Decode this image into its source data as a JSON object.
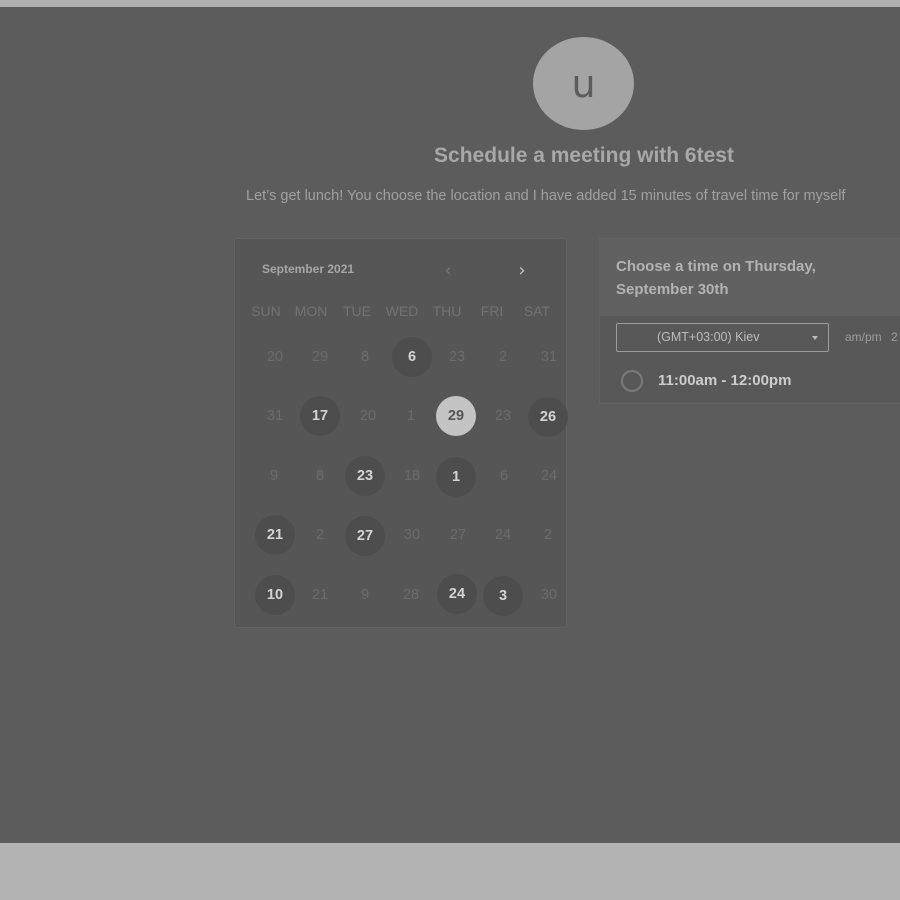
{
  "avatar": {
    "initial": "u"
  },
  "title": "Schedule a meeting with 6test",
  "description": "Let’s get lunch! You choose the location and I have added 15 minutes of travel time for myself",
  "calendar": {
    "month_label": "September 2021",
    "prev_icon": "chevron-left-icon",
    "next_icon": "chevron-right-icon",
    "weekdays": [
      "SUN",
      "MON",
      "TUE",
      "WED",
      "THU",
      "FRI",
      "SAT"
    ],
    "weeks": [
      [
        {
          "d": "20",
          "s": "off"
        },
        {
          "d": "29",
          "s": "off"
        },
        {
          "d": "8",
          "s": "off"
        },
        {
          "d": "6",
          "s": "avail"
        },
        {
          "d": "23",
          "s": "off"
        },
        {
          "d": "2",
          "s": "off"
        },
        {
          "d": "31",
          "s": "off"
        }
      ],
      [
        {
          "d": "31",
          "s": "off"
        },
        {
          "d": "17",
          "s": "avail"
        },
        {
          "d": "20",
          "s": "off"
        },
        {
          "d": "1",
          "s": "off"
        },
        {
          "d": "29",
          "s": "selected"
        },
        {
          "d": "23",
          "s": "off"
        },
        {
          "d": "26",
          "s": "avail"
        }
      ],
      [
        {
          "d": "9",
          "s": "off"
        },
        {
          "d": "8",
          "s": "off"
        },
        {
          "d": "23",
          "s": "avail"
        },
        {
          "d": "18",
          "s": "off"
        },
        {
          "d": "1",
          "s": "avail"
        },
        {
          "d": "6",
          "s": "off"
        },
        {
          "d": "24",
          "s": "off"
        }
      ],
      [
        {
          "d": "21",
          "s": "avail"
        },
        {
          "d": "2",
          "s": "off"
        },
        {
          "d": "27",
          "s": "avail"
        },
        {
          "d": "30",
          "s": "off"
        },
        {
          "d": "27",
          "s": "off"
        },
        {
          "d": "24",
          "s": "off"
        },
        {
          "d": "2",
          "s": "off"
        }
      ],
      [
        {
          "d": "10",
          "s": "avail"
        },
        {
          "d": "21",
          "s": "off"
        },
        {
          "d": "9",
          "s": "off"
        },
        {
          "d": "28",
          "s": "off"
        },
        {
          "d": "24",
          "s": "avail"
        },
        {
          "d": "3",
          "s": "avail"
        },
        {
          "d": "30",
          "s": "off"
        }
      ]
    ]
  },
  "times": {
    "heading": "Choose a time on Thursday, September 30th",
    "timezone": "(GMT+03:00) Kiev",
    "format_label": "am/pm",
    "format_extra": "2",
    "slots": [
      {
        "label": "11:00am - 12:00pm"
      }
    ]
  },
  "colors": {
    "page_background": "#5c5c5c",
    "outer_background": "#b3b3b3",
    "available_day": "#4d4d4d",
    "selected_day": "#c4c4c4"
  }
}
